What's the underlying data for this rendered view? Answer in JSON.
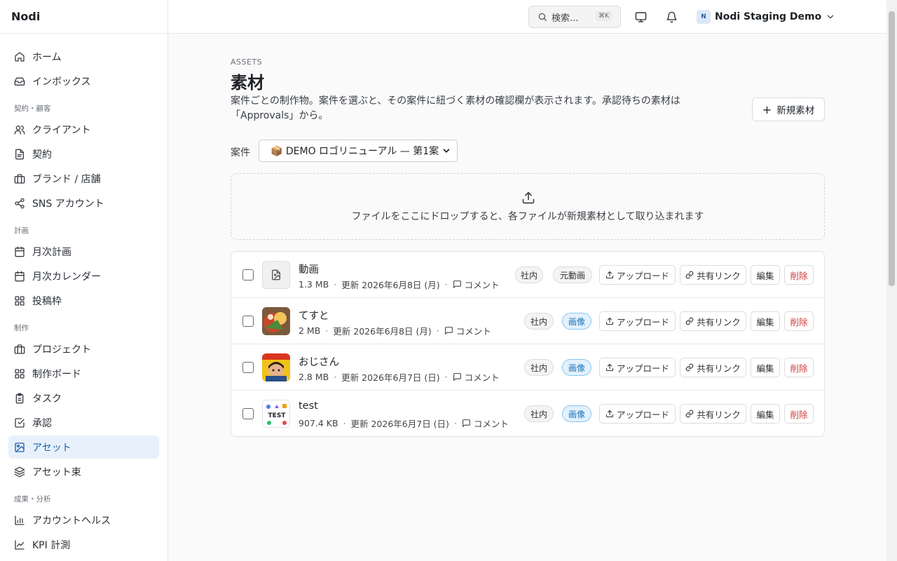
{
  "app": {
    "name": "Nodi"
  },
  "sidebar": {
    "groups": [
      {
        "label": "",
        "items": [
          {
            "label": "ホーム",
            "icon": "home-icon"
          },
          {
            "label": "インボックス",
            "icon": "inbox-icon"
          }
        ]
      },
      {
        "label": "契約・顧客",
        "items": [
          {
            "label": "クライアント",
            "icon": "users-icon"
          },
          {
            "label": "契約",
            "icon": "document-icon"
          },
          {
            "label": "ブランド / 店舗",
            "icon": "store-icon"
          },
          {
            "label": "SNS アカウント",
            "icon": "share-icon"
          }
        ]
      },
      {
        "label": "計画",
        "items": [
          {
            "label": "月次計画",
            "icon": "calendar-icon"
          },
          {
            "label": "月次カレンダー",
            "icon": "calendar-icon"
          },
          {
            "label": "投稿枠",
            "icon": "grid-icon"
          }
        ]
      },
      {
        "label": "制作",
        "items": [
          {
            "label": "プロジェクト",
            "icon": "briefcase-icon"
          },
          {
            "label": "制作ボード",
            "icon": "grid-icon"
          },
          {
            "label": "タスク",
            "icon": "clipboard-icon"
          },
          {
            "label": "承認",
            "icon": "check-square-icon"
          },
          {
            "label": "アセット",
            "icon": "image-icon",
            "active": true
          },
          {
            "label": "アセット束",
            "icon": "layers-icon"
          }
        ]
      },
      {
        "label": "成果・分析",
        "items": [
          {
            "label": "アカウントヘルス",
            "icon": "bar-chart-icon"
          },
          {
            "label": "KPI 計測",
            "icon": "line-chart-icon"
          }
        ]
      }
    ]
  },
  "topbar": {
    "search_label": "検索...",
    "search_shortcut": "⌘K",
    "monitor_icon": "monitor-icon",
    "bell_icon": "bell-icon",
    "workspace_badge": "N",
    "workspace_name": "Nodi Staging Demo"
  },
  "page": {
    "eyebrow": "ASSETS",
    "title": "素材",
    "description_line1": "案件ごとの制作物。案件を選ぶと、その案件に紐づく素材の確認欄が表示されます。承認待ちの素材は",
    "description_line2": "「Approvals」から。",
    "new_button": "新規素材",
    "case_label": "案件",
    "case_selected": "📦 DEMO ロゴリニューアル — 第1案",
    "dropzone_text": "ファイルをここにドロップすると、各ファイルが新規素材として取り込まれます"
  },
  "assets": [
    {
      "name": "動画",
      "size": "1.3 MB",
      "updated": "更新 2026年6月8日 (月)",
      "comment": "コメント",
      "tags": [
        "社内",
        "元動画"
      ],
      "thumb": "file"
    },
    {
      "name": "てすと",
      "size": "2 MB",
      "updated": "更新 2026年6月8日 (月)",
      "comment": "コメント",
      "tags": [
        "社内",
        "画像"
      ],
      "thumb": "food"
    },
    {
      "name": "おじさん",
      "size": "2.8 MB",
      "updated": "更新 2026年6月7日 (日)",
      "comment": "コメント",
      "tags": [
        "社内",
        "画像"
      ],
      "thumb": "person"
    },
    {
      "name": "test",
      "size": "907.4 KB",
      "updated": "更新 2026年6月7日 (日)",
      "comment": "コメント",
      "tags": [
        "社内",
        "画像"
      ],
      "thumb": "test"
    }
  ],
  "actions": {
    "upload": "アップロード",
    "share": "共有リンク",
    "edit": "編集",
    "delete": "削除"
  },
  "thumb_texts": {
    "test": "TEST"
  },
  "colors": {
    "accent": "#1b5fb0",
    "active_bg": "#e8f1fb",
    "image_tag": "#1a73b5",
    "delete": "#d23a3a"
  }
}
